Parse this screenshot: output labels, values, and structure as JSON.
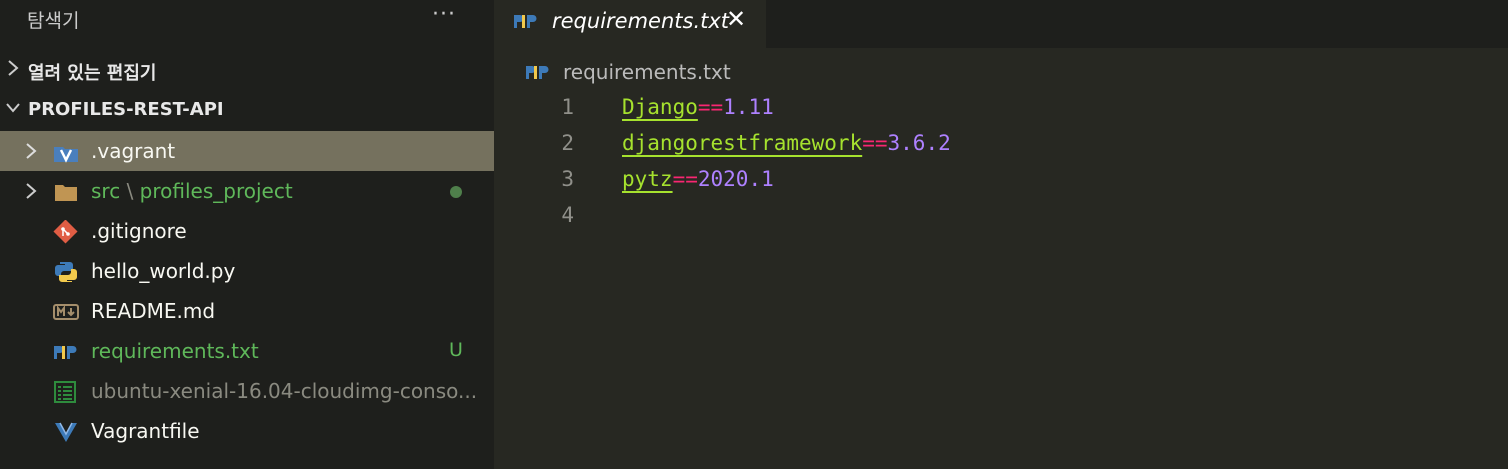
{
  "explorer": {
    "title": "탐색기",
    "more_label": "···",
    "open_editors_label": "열려 있는 편집기",
    "project_label": "PROFILES-REST-API",
    "items": [
      {
        "name": ".vagrant",
        "icon": "vagrant-folder-icon"
      },
      {
        "folder": "src",
        "separator": "\\",
        "subfolder": "profiles_project",
        "icon": "folder-icon",
        "status": "modified-dot"
      },
      {
        "name": ".gitignore",
        "icon": "git-icon"
      },
      {
        "name": "hello_world.py",
        "icon": "python-icon"
      },
      {
        "name": "README.md",
        "icon": "markdown-icon"
      },
      {
        "name": "requirements.txt",
        "icon": "pip-icon",
        "badge": "U"
      },
      {
        "name": "ubuntu-xenial-16.04-cloudimg-conso...",
        "icon": "log-file-icon"
      },
      {
        "name": "Vagrantfile",
        "icon": "vagrant-icon"
      }
    ]
  },
  "tab": {
    "label": "requirements.txt",
    "close": "✕"
  },
  "breadcrumb": {
    "label": "requirements.txt"
  },
  "editor": {
    "lines": [
      {
        "num": "1",
        "pkg": "Django",
        "op": "==",
        "ver": "1.11"
      },
      {
        "num": "2",
        "pkg": "djangorestframework",
        "op": "==",
        "ver": "3.6.2"
      },
      {
        "num": "3",
        "pkg": "pytz",
        "op": "==",
        "ver": "2020.1"
      },
      {
        "num": "4",
        "pkg": "",
        "op": "",
        "ver": ""
      }
    ]
  },
  "colors": {
    "sidebar_bg": "#1e1f1c",
    "editor_bg": "#272822",
    "selection": "#75715e",
    "package": "#a6e22e",
    "operator": "#f92672",
    "version": "#ae81ff",
    "git_untracked": "#5fb85a"
  }
}
